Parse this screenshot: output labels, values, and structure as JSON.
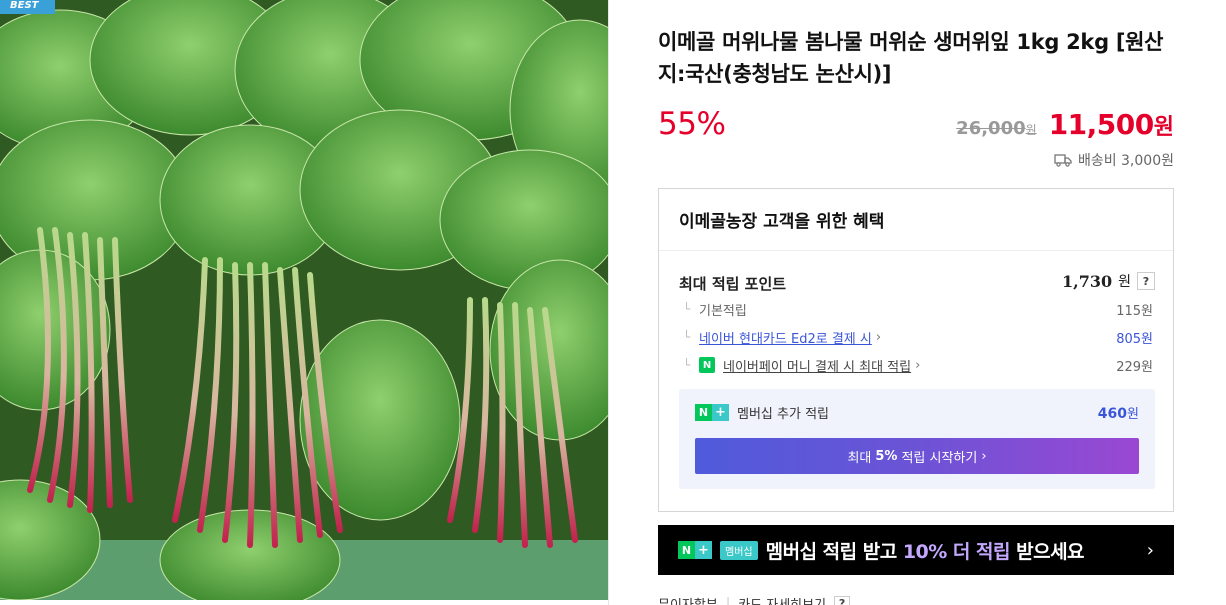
{
  "image": {
    "badge": "BEST",
    "alt_icon": "butterbur-vegetable-photo"
  },
  "product": {
    "title": "이메골 머위나물 봄나물 머위순 생머위잎 1kg 2kg [원산지:국산(충청남도 논산시)]",
    "discount": "55%",
    "original_price": "26,000",
    "original_unit": "원",
    "sale_price": "11,500",
    "sale_unit": "원",
    "shipping": "배송비 3,000원"
  },
  "benefit": {
    "heading": "이메골농장 고객을 위한 혜택",
    "max_points_label": "최대 적립 포인트",
    "max_points_value": "1,730",
    "max_points_unit": "원",
    "help": "?",
    "rows": [
      {
        "label": "기본적립",
        "value": "115원"
      },
      {
        "label": "네이버 현대카드 Ed2로 결제 시",
        "value": "805원"
      },
      {
        "label": "네이버페이 머니 결제 시 최대 적립",
        "value": "229원"
      }
    ],
    "membership_label": "멤버십 추가 적립",
    "membership_value": "460",
    "membership_unit": "원",
    "start_btn_pre": "최대",
    "start_btn_bold": "5%",
    "start_btn_post": "적립 시작하기"
  },
  "banner": {
    "badge": "멤버십",
    "text_pre": "멤버십 적립 받고",
    "text_hl": "10% 더 적립",
    "text_post": "받으세요"
  },
  "bottom": {
    "left": "무이자할부",
    "right": "카드 자세히보기"
  },
  "colors": {
    "discount_red": "#e4002b",
    "link_blue": "#3b55d8",
    "naver_green": "#03c75a"
  }
}
